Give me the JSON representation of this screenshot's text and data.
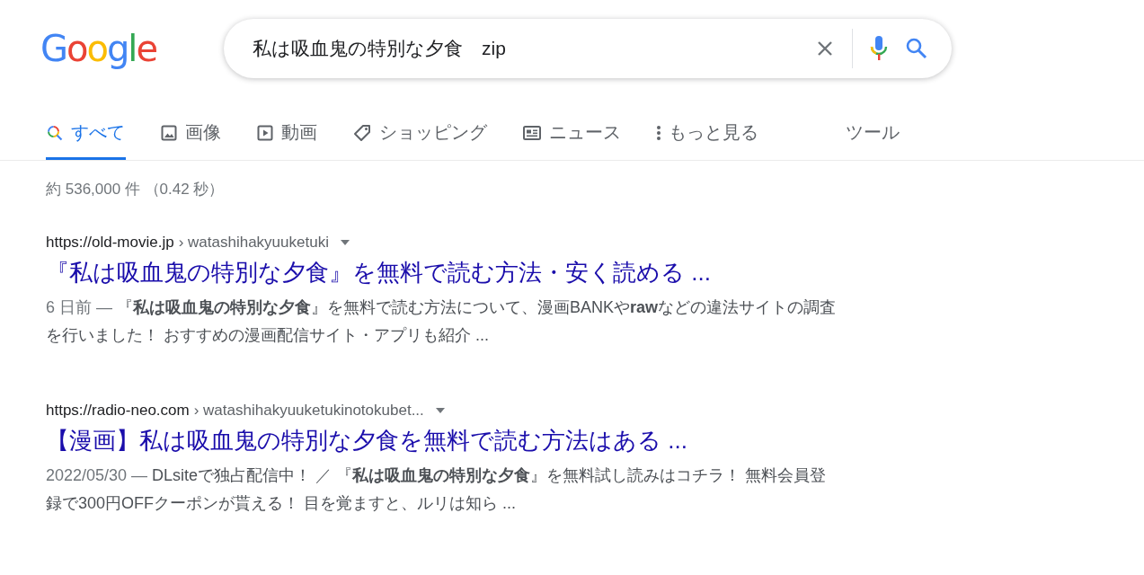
{
  "logo": "Google",
  "search": {
    "value": "私は吸血鬼の特別な夕食　zip"
  },
  "tabs": [
    {
      "label": "すべて",
      "kind": "all",
      "selected": true
    },
    {
      "label": "画像",
      "kind": "images",
      "selected": false
    },
    {
      "label": "動画",
      "kind": "videos",
      "selected": false
    },
    {
      "label": "ショッピング",
      "kind": "shopping",
      "selected": false
    },
    {
      "label": "ニュース",
      "kind": "news",
      "selected": false
    },
    {
      "label": "もっと見る",
      "kind": "more",
      "selected": false
    }
  ],
  "tools": "ツール",
  "result_stats": "約 536,000 件 （0.42 秒）",
  "results": [
    {
      "site": "https://old-movie.jp",
      "path": "› watashihakyuuketuki",
      "title": "『私は吸血鬼の特別な夕食』を無料で読む方法・安く読める ...",
      "date": "6 日前 — ",
      "snippet": "『**私は吸血鬼の特別な夕食**』を無料で読む方法について、漫画BANKや**raw**などの違法サイトの調査を行いました！ おすすめの漫画配信サイト・アプリも紹介 ..."
    },
    {
      "site": "https://radio-neo.com",
      "path": "› watashihakyuuketukinotokubet...",
      "title": "【漫画】私は吸血鬼の特別な夕食を無料で読む方法はある ...",
      "date": "2022/05/30 — ",
      "snippet": "DLsiteで独占配信中！ ／ 『**私は吸血鬼の特別な夕食**』を無料試し読みはコチラ！ 無料会員登録で300円OFFクーポンが貰える！ 目を覚ますと、ルリは知ら ..."
    }
  ]
}
